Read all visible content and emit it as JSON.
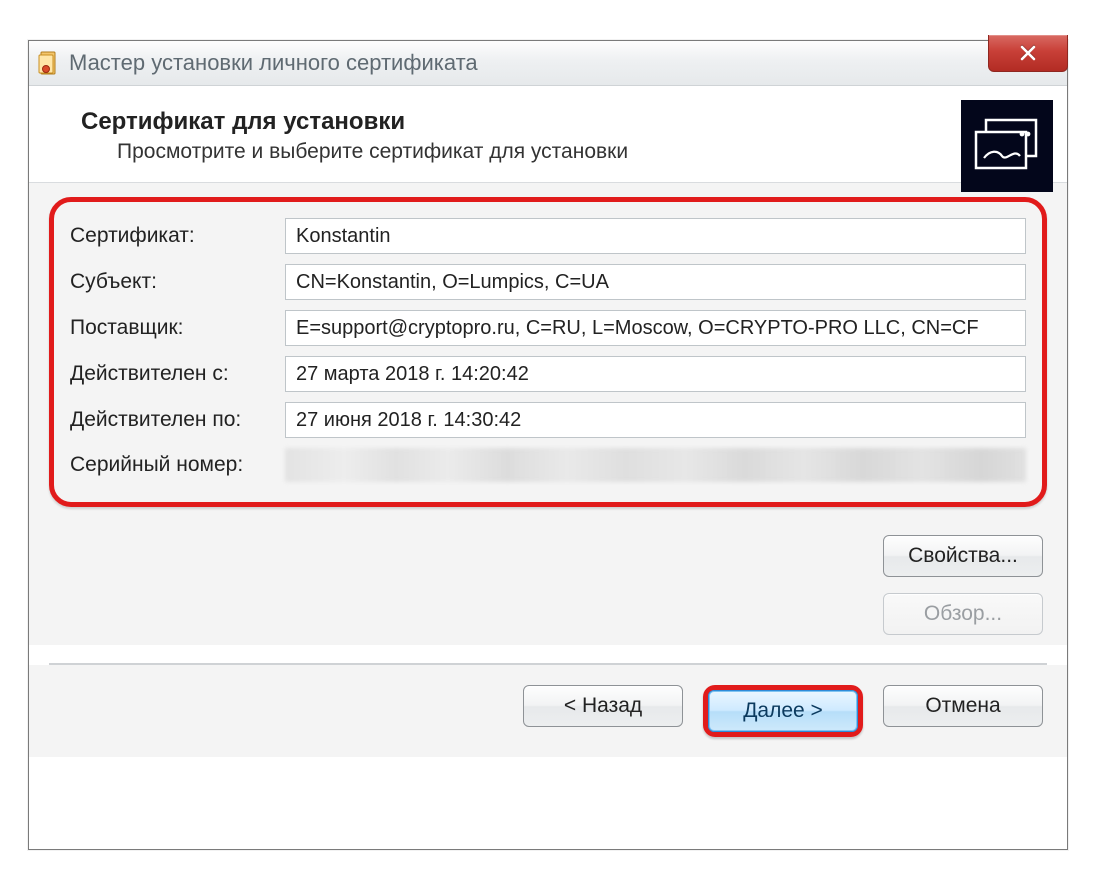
{
  "window": {
    "title": "Мастер установки личного сертификата"
  },
  "header": {
    "title": "Сертификат для установки",
    "subtitle": "Просмотрите и выберите сертификат для установки"
  },
  "fields": {
    "certificate_label": "Сертификат:",
    "certificate_value": "Konstantin",
    "subject_label": "Субъект:",
    "subject_value": "CN=Konstantin, O=Lumpics, C=UA",
    "issuer_label": "Поставщик:",
    "issuer_value": "E=support@cryptopro.ru, C=RU, L=Moscow, O=CRYPTO-PRO LLC, CN=CF",
    "valid_from_label": "Действителен с:",
    "valid_from_value": "27 марта 2018 г. 14:20:42",
    "valid_to_label": "Действителен по:",
    "valid_to_value": "27 июня 2018 г. 14:30:42",
    "serial_label": "Серийный номер:"
  },
  "buttons": {
    "properties": "Свойства...",
    "browse": "Обзор...",
    "back": "< Назад",
    "next": "Далее >",
    "cancel": "Отмена"
  }
}
